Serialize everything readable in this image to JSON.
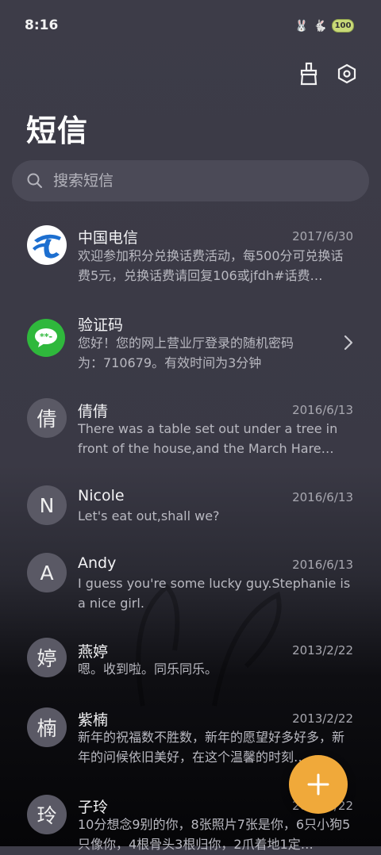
{
  "status": {
    "time": "8:16",
    "battery": "100"
  },
  "header": {
    "title": "短信"
  },
  "search": {
    "placeholder": "搜索短信"
  },
  "messages": [
    {
      "name": "中国电信",
      "date": "2017/6/30",
      "preview": "欢迎参加积分兑换话费活动，每500分可兑换话费5元，兑换话费请回复106或jfdh#话费…",
      "avatar": "telecom-logo"
    },
    {
      "name": "验证码",
      "date": "",
      "preview": "您好！您的网上营业厅登录的随机密码为：710679。有效时间为3分钟",
      "avatar": "message-bubble"
    },
    {
      "name": "倩倩",
      "date": "2016/6/13",
      "preview": "There was a table set out under a tree in front of the house,and the March Hare an…",
      "avatar": "倩"
    },
    {
      "name": "Nicole",
      "date": "2016/6/13",
      "preview": "Let's eat out,shall we?",
      "avatar": "N"
    },
    {
      "name": "Andy",
      "date": "2016/6/13",
      "preview": "I guess you're some lucky guy.Stephanie is a nice girl.",
      "avatar": "A"
    },
    {
      "name": "燕婷",
      "date": "2013/2/22",
      "preview": "嗯。收到啦。同乐同乐。",
      "avatar": "婷"
    },
    {
      "name": "紫楠",
      "date": "2013/2/22",
      "preview": "新年的祝福数不胜数，新年的愿望好多好多，新年的问候依旧美好，在这个温馨的时刻…",
      "avatar": "楠"
    },
    {
      "name": "子玲",
      "date": "2013/2/22",
      "preview": "10分想念9别的你，8张照片7张是你，6只小狗5只像你，4根骨头3根归你，2爪着地1定…",
      "avatar": "玲"
    }
  ],
  "colors": {
    "accent": "#f0a93a",
    "telecom": "#1d6fd0",
    "wechat_green": "#2fb83c"
  }
}
